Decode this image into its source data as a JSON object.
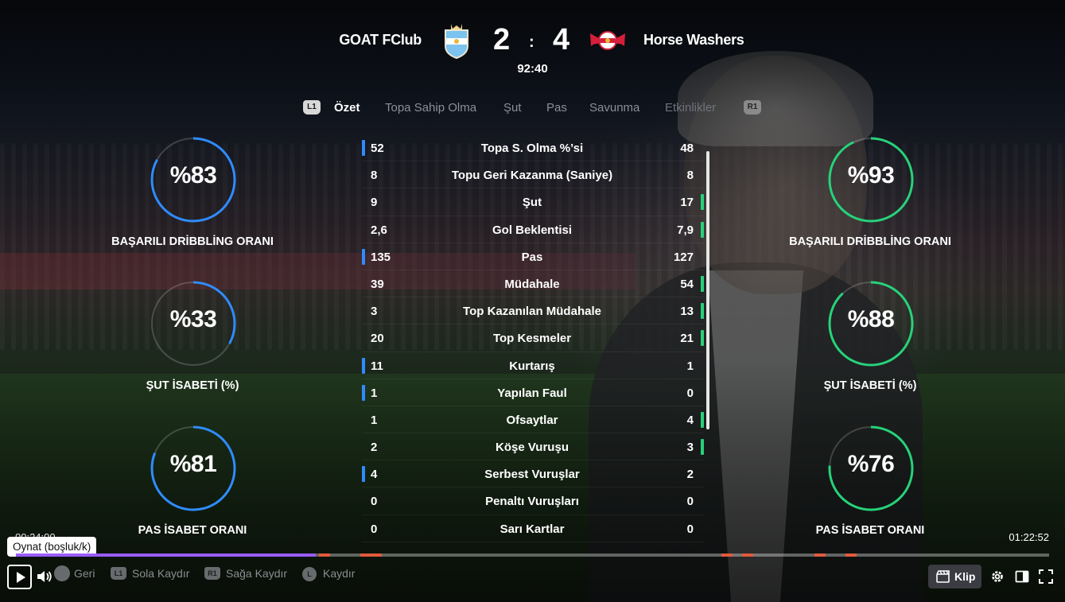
{
  "scoreboard": {
    "home_team": "GOAT FClub",
    "away_team": "Horse Washers",
    "home_score": "2",
    "separator": ":",
    "away_score": "4",
    "match_time": "92:40",
    "home_crest_icon": "argentina-crest-icon",
    "away_crest_icon": "rb-leipzig-crest-icon"
  },
  "tabs": {
    "left_button": "L1",
    "right_button": "R1",
    "items": [
      {
        "label": "Özet",
        "active": true
      },
      {
        "label": "Topa Sahip Olma",
        "active": false
      },
      {
        "label": "Şut",
        "active": false
      },
      {
        "label": "Pas",
        "active": false
      },
      {
        "label": "Savunma",
        "active": false
      },
      {
        "label": "Etkinlikler",
        "active": false
      }
    ]
  },
  "home_rings": [
    {
      "value": "%83",
      "label": "BAŞARILI DRİBBLİNG ORANI",
      "fraction": 0.83
    },
    {
      "value": "%33",
      "label": "ŞUT İSABETİ (%)",
      "fraction": 0.33
    },
    {
      "value": "%81",
      "label": "PAS İSABET ORANI",
      "fraction": 0.81
    }
  ],
  "away_rings": [
    {
      "value": "%93",
      "label": "BAŞARILI DRİBBLİNG ORANI",
      "fraction": 0.93
    },
    {
      "value": "%88",
      "label": "ŞUT İSABETİ (%)",
      "fraction": 0.88
    },
    {
      "value": "%76",
      "label": "PAS İSABET ORANI",
      "fraction": 0.76
    }
  ],
  "colors": {
    "home": "#2f8cff",
    "away": "#27d27a",
    "progress": "#9a5cff",
    "marker": "#e25a3c"
  },
  "stats": [
    {
      "home": "52",
      "label": "Topa S. Olma %’si",
      "away": "48",
      "leader": "home"
    },
    {
      "home": "8",
      "label": "Topu Geri Kazanma (Saniye)",
      "away": "8",
      "leader": "none"
    },
    {
      "home": "9",
      "label": "Şut",
      "away": "17",
      "leader": "away"
    },
    {
      "home": "2,6",
      "label": "Gol Beklentisi",
      "away": "7,9",
      "leader": "away"
    },
    {
      "home": "135",
      "label": "Pas",
      "away": "127",
      "leader": "home"
    },
    {
      "home": "39",
      "label": "Müdahale",
      "away": "54",
      "leader": "away"
    },
    {
      "home": "3",
      "label": "Top Kazanılan Müdahale",
      "away": "13",
      "leader": "away"
    },
    {
      "home": "20",
      "label": "Top Kesmeler",
      "away": "21",
      "leader": "away"
    },
    {
      "home": "11",
      "label": "Kurtarış",
      "away": "1",
      "leader": "home"
    },
    {
      "home": "1",
      "label": "Yapılan Faul",
      "away": "0",
      "leader": "home"
    },
    {
      "home": "1",
      "label": "Ofsaytlar",
      "away": "4",
      "leader": "away"
    },
    {
      "home": "2",
      "label": "Köşe Vuruşu",
      "away": "3",
      "leader": "away"
    },
    {
      "home": "4",
      "label": "Serbest Vuruşlar",
      "away": "2",
      "leader": "home"
    },
    {
      "home": "0",
      "label": "Penaltı Vuruşları",
      "away": "0",
      "leader": "none"
    },
    {
      "home": "0",
      "label": "Sarı Kartlar",
      "away": "0",
      "leader": "none"
    }
  ],
  "player": {
    "tooltip": "Oynat (boşluk/k)",
    "current_time": "00:24:00",
    "duration": "01:22:52",
    "progress_fraction": 0.29,
    "markers": [
      0.293,
      0.333,
      0.343,
      0.683,
      0.703,
      0.773,
      0.803
    ],
    "hints": [
      {
        "icon": "circle-button-icon",
        "label": "Geri"
      },
      {
        "icon": "L1",
        "label": "Sola Kaydır"
      },
      {
        "icon": "R1",
        "label": "Sağa Kaydır"
      },
      {
        "icon": "L",
        "label": "Kaydır"
      }
    ],
    "clip_label": "Klip",
    "icons": [
      "play-icon",
      "volume-icon",
      "clip-icon",
      "settings-icon",
      "theater-mode-icon",
      "fullscreen-icon"
    ]
  }
}
